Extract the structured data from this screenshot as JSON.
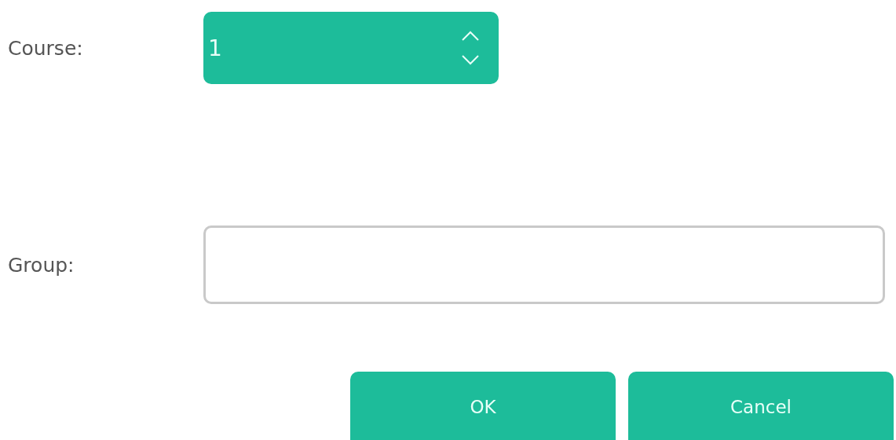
{
  "course": {
    "label": "Course:",
    "value": "1"
  },
  "group": {
    "label": "Group:"
  },
  "buttons": [
    {
      "label": "OK"
    },
    {
      "label": "Cancel"
    }
  ]
}
